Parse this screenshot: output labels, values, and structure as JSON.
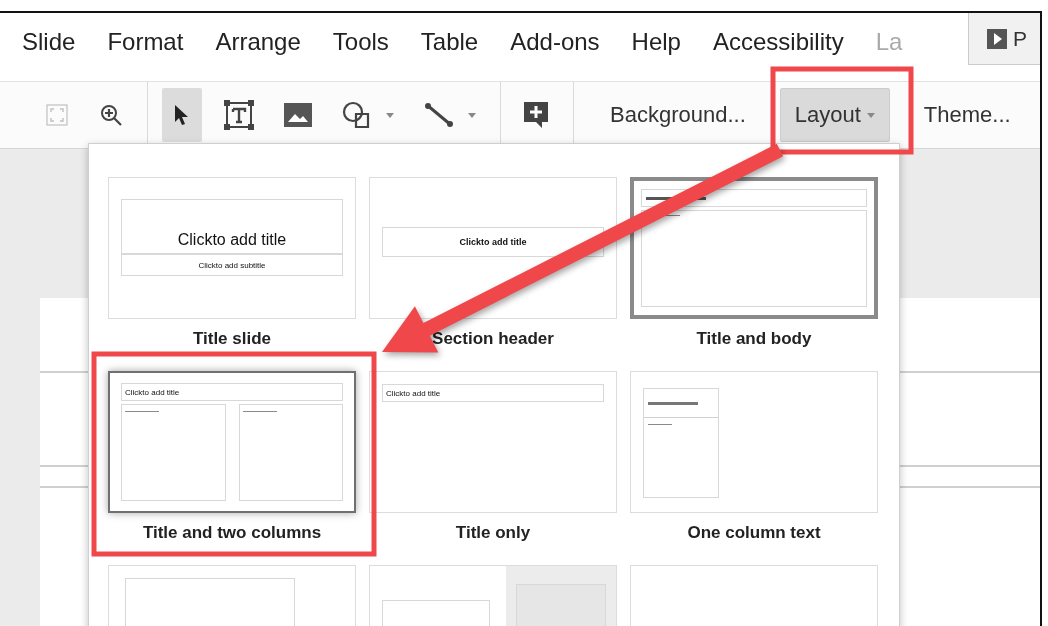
{
  "menu": {
    "items": [
      {
        "label": "Slide",
        "dimmed": false
      },
      {
        "label": "Format",
        "dimmed": false
      },
      {
        "label": "Arrange",
        "dimmed": false
      },
      {
        "label": "Tools",
        "dimmed": false
      },
      {
        "label": "Table",
        "dimmed": false
      },
      {
        "label": "Add-ons",
        "dimmed": false
      },
      {
        "label": "Help",
        "dimmed": false
      },
      {
        "label": "Accessibility",
        "dimmed": false
      },
      {
        "label": "La",
        "dimmed": true
      }
    ],
    "present_button": {
      "label": "P"
    }
  },
  "toolbar": {
    "tools": [
      {
        "kind": "fit",
        "disabled": true,
        "pressed": false,
        "has_menu": false
      },
      {
        "kind": "zoom",
        "disabled": false,
        "pressed": false,
        "has_menu": false
      },
      {
        "kind": "separator"
      },
      {
        "kind": "select",
        "disabled": false,
        "pressed": true,
        "has_menu": false
      },
      {
        "kind": "textbox",
        "disabled": false,
        "pressed": false,
        "has_menu": false
      },
      {
        "kind": "image",
        "disabled": false,
        "pressed": false,
        "has_menu": false
      },
      {
        "kind": "shape",
        "disabled": false,
        "pressed": false,
        "has_menu": true
      },
      {
        "kind": "line",
        "disabled": false,
        "pressed": false,
        "has_menu": true
      },
      {
        "kind": "separator"
      },
      {
        "kind": "comment",
        "disabled": false,
        "pressed": false,
        "has_menu": false
      },
      {
        "kind": "separator"
      }
    ],
    "text_buttons": [
      {
        "label": "Background...",
        "pressed": false,
        "has_menu": false
      },
      {
        "label": "Layout",
        "pressed": true,
        "has_menu": true
      },
      {
        "label": "Theme...",
        "pressed": false,
        "has_menu": false
      }
    ]
  },
  "layouts": {
    "items": [
      {
        "label": "Title slide",
        "kind": "title_slide",
        "selected": false,
        "hovered": false,
        "texts": [
          "Clickto add title",
          "Clickto add subtitle"
        ]
      },
      {
        "label": "Section header",
        "kind": "section_header",
        "selected": false,
        "hovered": false,
        "texts": [
          "Clickto add title"
        ]
      },
      {
        "label": "Title and body",
        "kind": "title_body",
        "selected": true,
        "hovered": false
      },
      {
        "label": "Title and two columns",
        "kind": "two_columns",
        "selected": false,
        "hovered": true,
        "texts": [
          "Clickto add title"
        ]
      },
      {
        "label": "Title only",
        "kind": "title_only",
        "selected": false,
        "hovered": false,
        "texts": [
          "Clickto add title"
        ]
      },
      {
        "label": "One column text",
        "kind": "one_column",
        "selected": false,
        "hovered": false
      },
      {
        "kind": "big_box",
        "selected": false,
        "hovered": false
      },
      {
        "kind": "split",
        "selected": false,
        "hovered": false
      },
      {
        "kind": "blank",
        "selected": false,
        "hovered": false
      }
    ]
  },
  "annotations": [
    {
      "kind": "highlight_frame"
    },
    {
      "kind": "highlight_frame"
    },
    {
      "kind": "arrow"
    }
  ]
}
